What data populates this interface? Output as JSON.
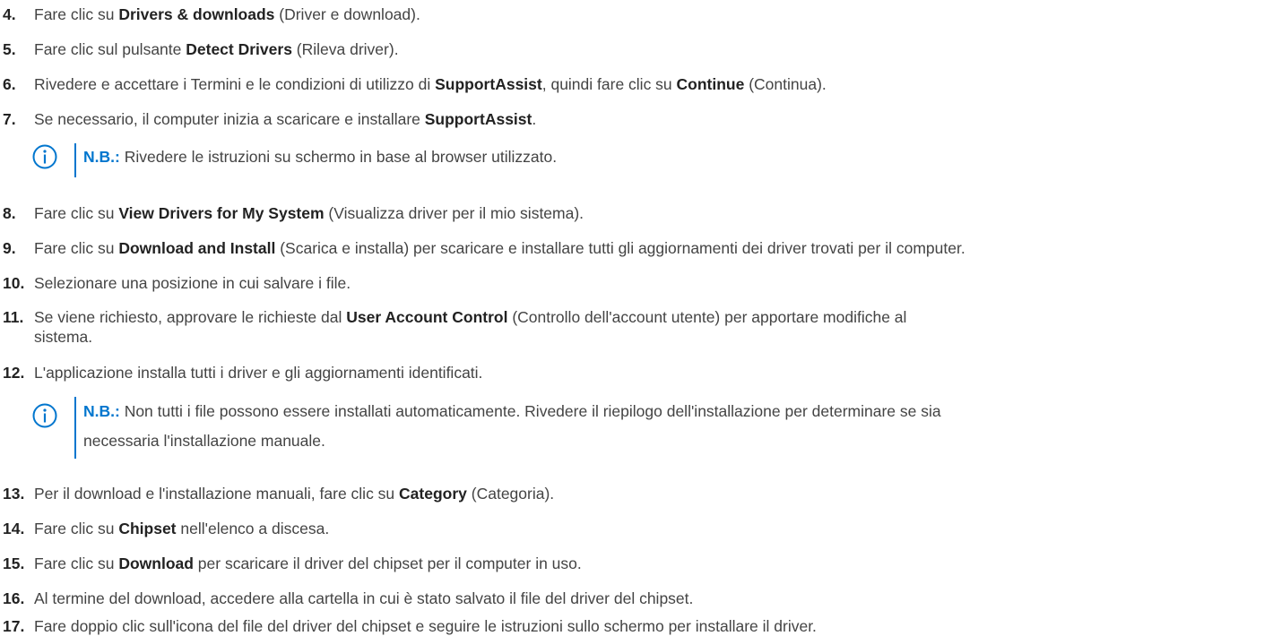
{
  "steps": [
    {
      "num": "4.",
      "pre": "Fare clic su ",
      "bold": "Drivers & downloads",
      "post": " (Driver e download)."
    },
    {
      "num": "5.",
      "pre": "Fare clic sul pulsante ",
      "bold": "Detect Drivers",
      "post": " (Rileva driver)."
    },
    {
      "num": "6.",
      "pre": "Rivedere e accettare i Termini e le condizioni di utilizzo di ",
      "bold": "SupportAssist",
      "mid": ", quindi fare clic su ",
      "bold2": "Continue",
      "post": " (Continua)."
    },
    {
      "num": "7.",
      "pre": "Se necessario, il computer inizia a scaricare e installare ",
      "bold": "SupportAssist",
      "post": "."
    },
    {
      "num": "8.",
      "pre": "Fare clic su ",
      "bold": "View Drivers for My System",
      "post": " (Visualizza driver per il mio sistema)."
    },
    {
      "num": "9.",
      "pre": "Fare clic su ",
      "bold": "Download and Install",
      "post": " (Scarica e installa) per scaricare e installare tutti gli aggiornamenti dei driver trovati per il computer."
    },
    {
      "num": "10.",
      "pre": "Selezionare una posizione in cui salvare i file."
    },
    {
      "num": "11.",
      "pre": "Se viene richiesto, approvare le richieste dal ",
      "bold": "User Account Control",
      "post": " (Controllo dell'account utente) per apportare modifiche al",
      "line2": "sistema."
    },
    {
      "num": "12.",
      "pre": "L'applicazione installa tutti i driver e gli aggiornamenti identificati."
    },
    {
      "num": "13.",
      "pre": "Per il download e l'installazione manuali, fare clic su ",
      "bold": "Category",
      "post": " (Categoria)."
    },
    {
      "num": "14.",
      "pre": "Fare clic su ",
      "bold": "Chipset",
      "post": " nell'elenco a discesa."
    },
    {
      "num": "15.",
      "pre": "Fare clic su ",
      "bold": "Download",
      "post": " per scaricare il driver del chipset per il computer in uso."
    },
    {
      "num": "16.",
      "pre": "Al termine del download, accedere alla cartella in cui è stato salvato il file del driver del chipset."
    },
    {
      "num": "17.",
      "pre": "Fare doppio clic sull'icona del file del driver del chipset e seguire le istruzioni sullo schermo per installare il driver."
    }
  ],
  "notes": [
    {
      "label": "N.B.:",
      "text": " Rivedere le istruzioni su schermo in base al browser utilizzato."
    },
    {
      "label": "N.B.:",
      "text": " Non tutti i file possono essere installati automaticamente. Rivedere il riepilogo dell'installazione per determinare se sia",
      "line2": "necessaria l'installazione manuale."
    }
  ],
  "icons": {
    "note": "info-circle-icon"
  },
  "colors": {
    "accent": "#0076ce",
    "text": "#444444"
  }
}
